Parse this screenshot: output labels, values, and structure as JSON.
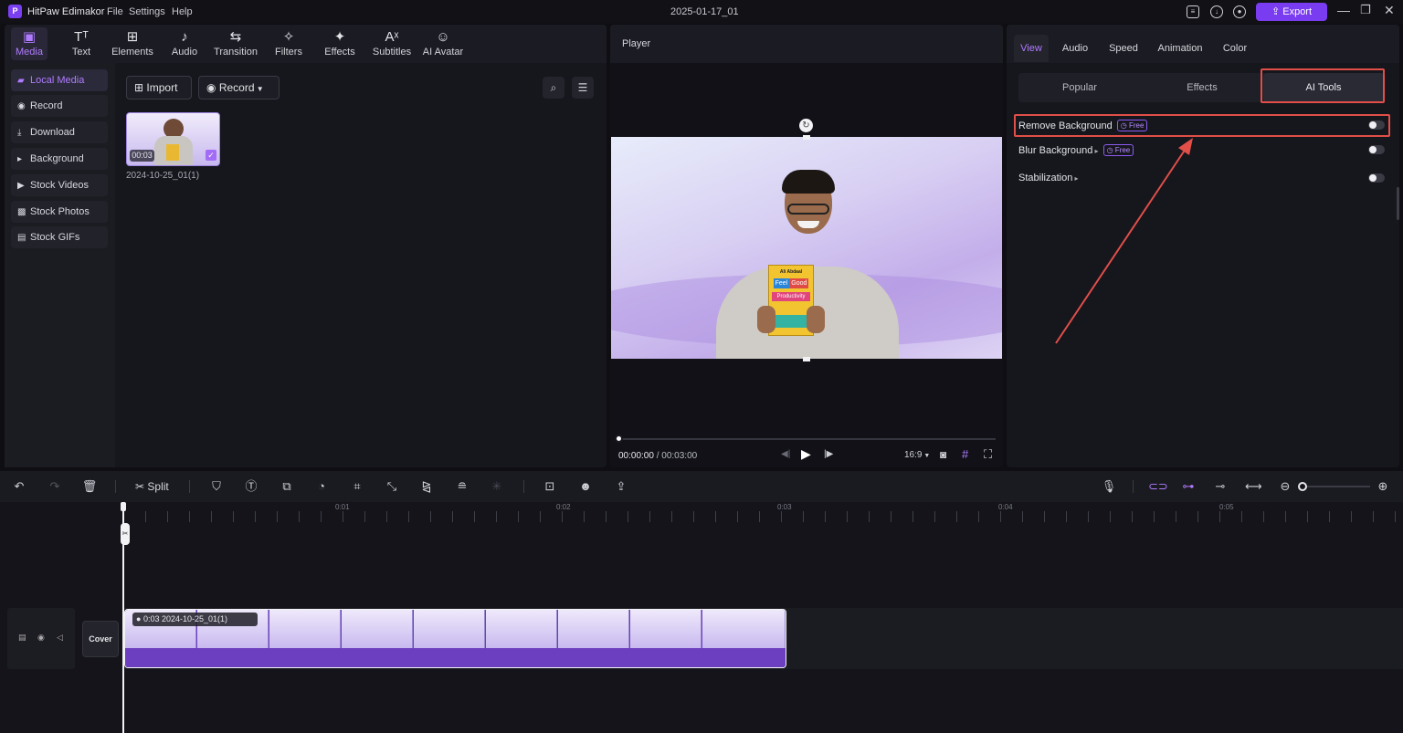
{
  "titlebar": {
    "app_name": "HitPaw Edimakor",
    "menu": [
      "File",
      "Settings",
      "Help"
    ],
    "project_title": "2025-01-17_01",
    "export_label": "Export"
  },
  "toolbar": {
    "tools": [
      {
        "label": "Media",
        "icon": "media-icon"
      },
      {
        "label": "Text",
        "icon": "text-icon"
      },
      {
        "label": "Elements",
        "icon": "elements-icon"
      },
      {
        "label": "Audio",
        "icon": "audio-icon"
      },
      {
        "label": "Transition",
        "icon": "transition-icon"
      },
      {
        "label": "Filters",
        "icon": "filters-icon"
      },
      {
        "label": "Effects",
        "icon": "effects-icon"
      },
      {
        "label": "Subtitles",
        "icon": "subtitles-icon"
      },
      {
        "label": "AI Avatar",
        "icon": "ai-avatar-icon"
      }
    ]
  },
  "sidebar": {
    "items": [
      "Local Media",
      "Record",
      "Download",
      "Background",
      "Stock Videos",
      "Stock Photos",
      "Stock GIFs"
    ]
  },
  "media": {
    "import_label": "Import",
    "record_label": "Record",
    "clip_duration": "00:03",
    "clip_name": "2024-10-25_01(1)"
  },
  "player": {
    "label": "Player",
    "current_time": "00:00:00",
    "separator": "/",
    "total_time": "00:03:00",
    "aspect_ratio": "16:9",
    "book_lines": [
      "Ali Abdaal",
      "Feel",
      "Good",
      "Productivity"
    ]
  },
  "properties": {
    "tabs": [
      "View",
      "Audio",
      "Speed",
      "Animation",
      "Color"
    ],
    "subtabs": [
      "Popular",
      "Effects",
      "AI Tools"
    ],
    "options": [
      {
        "label": "Remove Background",
        "badge": "Free"
      },
      {
        "label": "Blur Background",
        "badge": "Free"
      },
      {
        "label": "Stabilization",
        "badge": ""
      }
    ]
  },
  "timeline": {
    "split_label": "Split",
    "ruler": [
      "0:01",
      "0:02",
      "0:03",
      "0:04",
      "0:05"
    ],
    "cover_label": "Cover",
    "clip_label": "0:03 2024-10-25_01(1)"
  },
  "colors": {
    "accent": "#7a3cf0",
    "highlight_box": "#e14f48",
    "audio_track": "#6b3fbf"
  }
}
